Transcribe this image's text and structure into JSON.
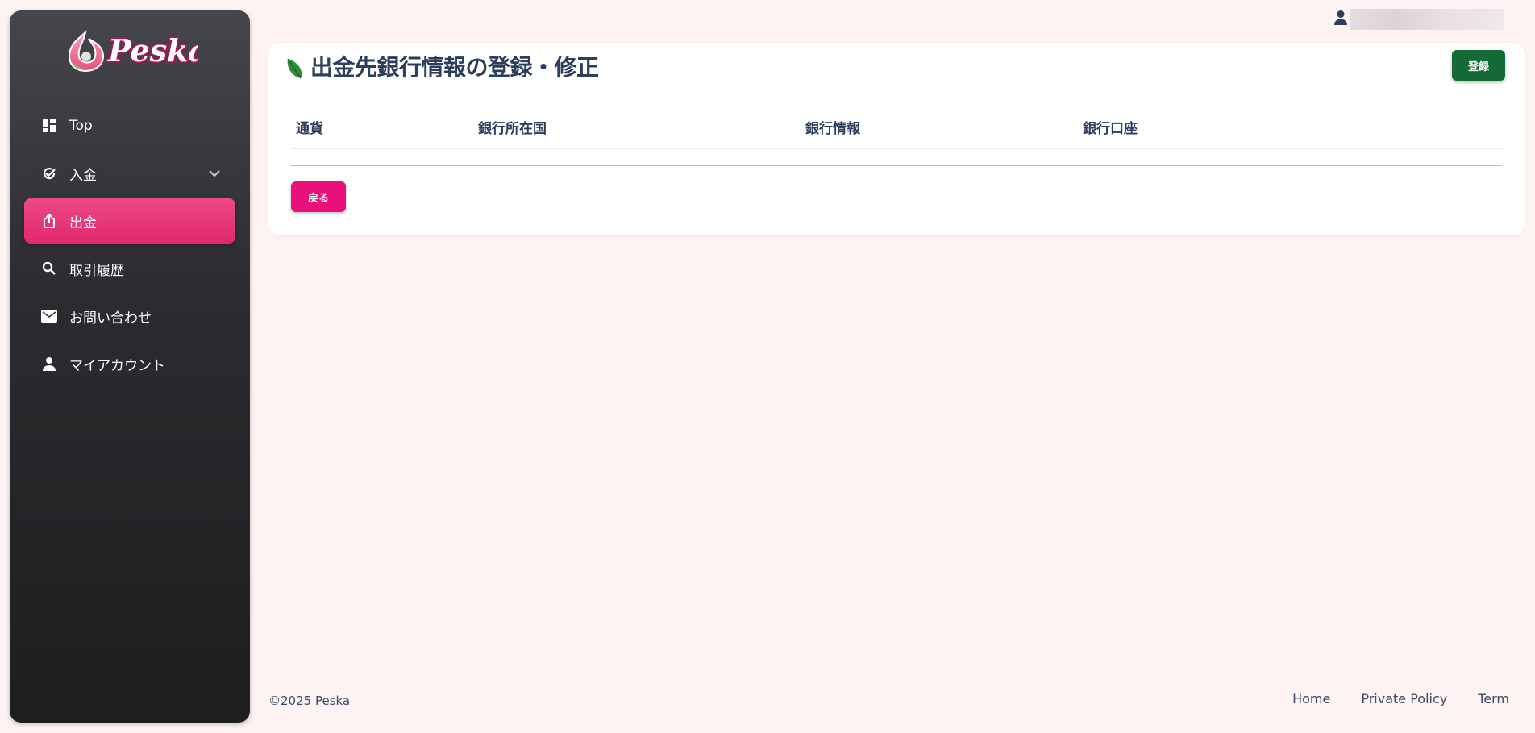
{
  "brand": {
    "logo_text": "Peska",
    "colors": {
      "pink": "#e8117a",
      "green": "#136a36",
      "navy": "#2c3e5c"
    }
  },
  "sidebar": {
    "items": [
      {
        "label": "Top",
        "icon": "dashboard-icon"
      },
      {
        "label": "入金",
        "icon": "deposit-check-icon",
        "has_chevron": true
      },
      {
        "label": "出金",
        "icon": "upload-icon",
        "active": true
      },
      {
        "label": "取引履歴",
        "icon": "search-icon"
      },
      {
        "label": "お問い合わせ",
        "icon": "mail-icon"
      },
      {
        "label": "マイアカウント",
        "icon": "person-icon"
      }
    ]
  },
  "header": {
    "user_icon": "person-icon"
  },
  "main": {
    "title": "出金先銀行情報の登録・修正",
    "register_label": "登録",
    "table": {
      "columns": [
        "通貨",
        "銀行所在国",
        "銀行情報",
        "銀行口座"
      ],
      "rows": []
    },
    "back_label": "戻る"
  },
  "footer": {
    "copyright": "©2025 Peska",
    "links": [
      "Home",
      "Private Policy",
      "Term"
    ]
  }
}
